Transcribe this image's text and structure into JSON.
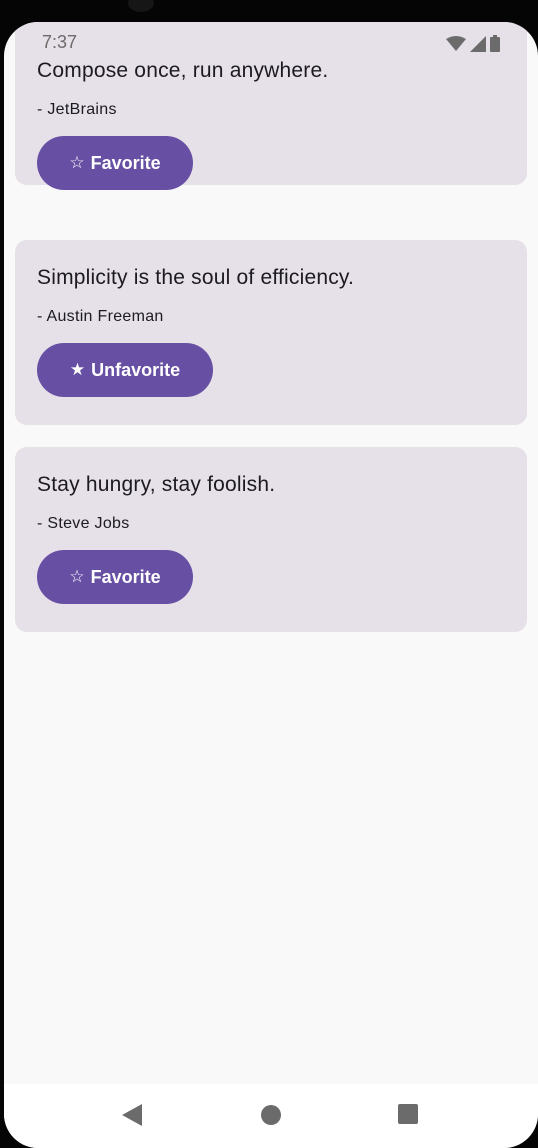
{
  "status_bar": {
    "time": "7:37",
    "icons": [
      "wifi-icon",
      "cellular-signal-icon",
      "battery-icon"
    ]
  },
  "quotes": [
    {
      "text": "Compose once, run anywhere.",
      "author": "- JetBrains",
      "button_icon": "☆",
      "button_label": "Favorite",
      "favorited": false
    },
    {
      "text": "Simplicity is the soul of efficiency.",
      "author": "- Austin Freeman",
      "button_icon": "★",
      "button_label": "Unfavorite",
      "favorited": true
    },
    {
      "text": "Stay hungry, stay foolish.",
      "author": "- Steve Jobs",
      "button_icon": "☆",
      "button_label": "Favorite",
      "favorited": false
    }
  ],
  "nav_bar": {
    "icons": [
      "back-icon",
      "home-icon",
      "recents-icon"
    ]
  },
  "colors": {
    "card_background": "#e6e0e8",
    "button_background": "#6750a4",
    "screen_background": "#f9f9f9",
    "text": "#1c1b1f"
  }
}
